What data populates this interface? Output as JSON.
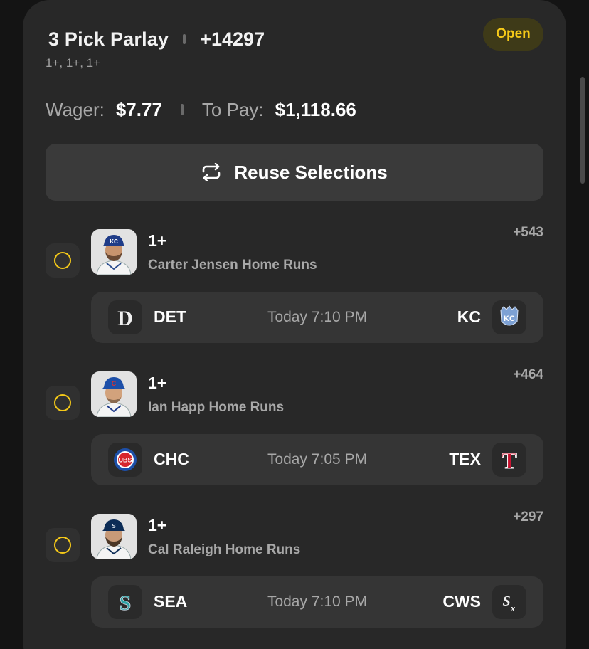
{
  "header": {
    "title": "3 Pick Parlay",
    "total_odds": "+14297",
    "subtitle": "1+, 1+, 1+",
    "status": "Open"
  },
  "wager": {
    "wager_label": "Wager:",
    "wager_value": "$7.77",
    "pay_label": "To Pay:",
    "pay_value": "$1,118.66"
  },
  "reuse_label": "Reuse Selections",
  "legs": [
    {
      "line": "1+",
      "description": "Carter Jensen Home Runs",
      "odds": "+543",
      "away": "DET",
      "home": "KC",
      "time": "Today 7:10 PM"
    },
    {
      "line": "1+",
      "description": "Ian Happ Home Runs",
      "odds": "+464",
      "away": "CHC",
      "home": "TEX",
      "time": "Today 7:05 PM"
    },
    {
      "line": "1+",
      "description": "Cal Raleigh Home Runs",
      "odds": "+297",
      "away": "SEA",
      "home": "CWS",
      "time": "Today 7:10 PM"
    }
  ],
  "colors": {
    "accent": "#f5c918",
    "card": "#282828",
    "background": "#141414"
  }
}
